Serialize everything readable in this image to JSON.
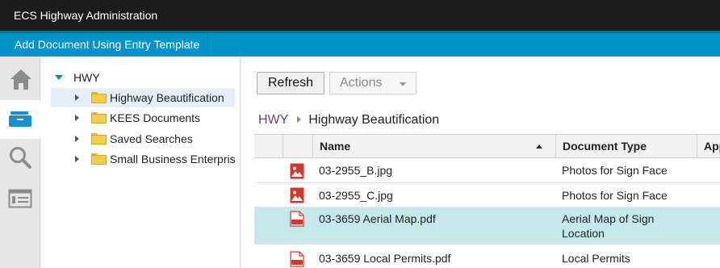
{
  "app": {
    "title": "ECS Highway Administration"
  },
  "tabs": [
    {
      "label": "Add Document Using Entry Template"
    }
  ],
  "leftnav": {
    "items": [
      {
        "icon": "home-icon"
      },
      {
        "icon": "browse-icon",
        "active": true
      },
      {
        "icon": "search-icon"
      },
      {
        "icon": "work-items-icon"
      }
    ]
  },
  "tree": {
    "root": "HWY",
    "items": [
      {
        "label": "Highway Beautification",
        "selected": true
      },
      {
        "label": "KEES Documents"
      },
      {
        "label": "Saved Searches"
      },
      {
        "label": "Small Business Enterpris"
      }
    ]
  },
  "toolbar": {
    "refresh_label": "Refresh",
    "actions_label": "Actions"
  },
  "breadcrumb": {
    "root": "HWY",
    "current": "Highway Beautification"
  },
  "grid": {
    "columns": {
      "name": "Name",
      "doc_type": "Document Type",
      "app": "App"
    },
    "sort": {
      "column": "Name",
      "direction": "ascending"
    },
    "rows": [
      {
        "name": "03-2955_B.jpg",
        "doc_type": "Photos for Sign Face",
        "icon": "image-file-icon"
      },
      {
        "name": "03-2955_C.jpg",
        "doc_type": "Photos for Sign Face",
        "icon": "image-file-icon"
      },
      {
        "name": "03-3659 Aerial Map.pdf",
        "doc_type_line1": "Aerial Map of Sign",
        "doc_type_line2": "Location",
        "icon": "pdf-file-icon",
        "selected": true,
        "pdf_badge": "pdf"
      },
      {
        "name": "03-3659 Local Permits.pdf",
        "doc_type": "Local Permits",
        "icon": "pdf-file-icon",
        "pdf_badge": "pdf"
      }
    ]
  },
  "colors": {
    "accent": "#0094c9",
    "titlebar": "#1c1c1c",
    "selected_row": "#c5e8ea",
    "breadcrumb_link": "#6a3d7d"
  }
}
